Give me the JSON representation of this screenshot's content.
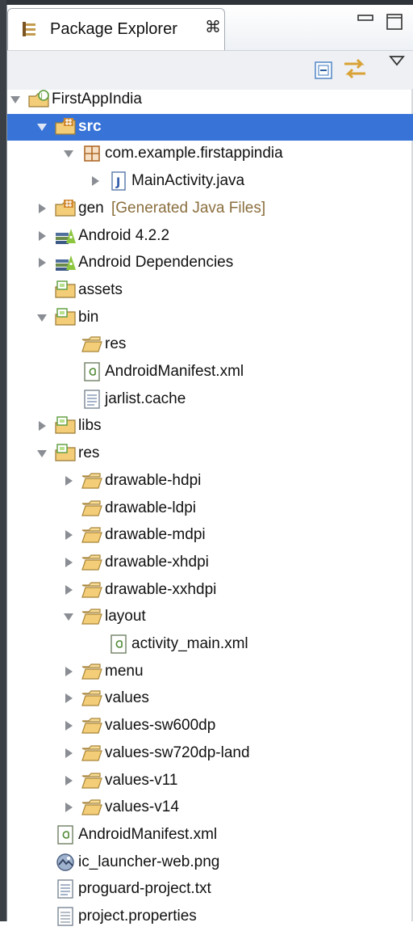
{
  "view": {
    "tab_title": "Package Explorer",
    "close_glyph": "⌘"
  },
  "tree": [
    {
      "id": "firstappindia",
      "label": "FirstAppIndia",
      "level": 0,
      "expanded": true,
      "icon": "android-project-icon"
    },
    {
      "id": "src",
      "label": "src",
      "level": 1,
      "expanded": true,
      "icon": "source-folder-icon",
      "selected": true
    },
    {
      "id": "com-example-firstappindia",
      "label": "com.example.firstappindia",
      "level": 2,
      "expanded": true,
      "icon": "package-icon"
    },
    {
      "id": "mainactivity-java",
      "label": "MainActivity.java",
      "level": 3,
      "expanded": false,
      "icon": "java-file-icon"
    },
    {
      "id": "gen",
      "label": "gen",
      "decoration": "[Generated Java Files]",
      "level": 1,
      "expanded": false,
      "icon": "source-folder-icon"
    },
    {
      "id": "android-4-2-2",
      "label": "Android 4.2.2",
      "level": 1,
      "expanded": false,
      "icon": "library-icon"
    },
    {
      "id": "android-dependencies",
      "label": "Android Dependencies",
      "level": 1,
      "expanded": false,
      "icon": "library-icon"
    },
    {
      "id": "assets",
      "label": "assets",
      "level": 1,
      "icon": "resource-folder-icon"
    },
    {
      "id": "bin",
      "label": "bin",
      "level": 1,
      "expanded": true,
      "icon": "resource-folder-icon"
    },
    {
      "id": "bin-res",
      "label": "res",
      "level": 2,
      "icon": "folder-icon"
    },
    {
      "id": "bin-androidmanifest",
      "label": "AndroidManifest.xml",
      "level": 2,
      "icon": "xml-file-icon"
    },
    {
      "id": "jarlist-cache",
      "label": "jarlist.cache",
      "level": 2,
      "icon": "text-file-icon"
    },
    {
      "id": "libs",
      "label": "libs",
      "level": 1,
      "expanded": false,
      "icon": "resource-folder-icon"
    },
    {
      "id": "res",
      "label": "res",
      "level": 1,
      "expanded": true,
      "icon": "resource-folder-icon"
    },
    {
      "id": "drawable-hdpi",
      "label": "drawable-hdpi",
      "level": 2,
      "expanded": false,
      "icon": "folder-icon"
    },
    {
      "id": "drawable-ldpi",
      "label": "drawable-ldpi",
      "level": 2,
      "icon": "folder-icon"
    },
    {
      "id": "drawable-mdpi",
      "label": "drawable-mdpi",
      "level": 2,
      "expanded": false,
      "icon": "folder-icon"
    },
    {
      "id": "drawable-xhdpi",
      "label": "drawable-xhdpi",
      "level": 2,
      "expanded": false,
      "icon": "folder-icon"
    },
    {
      "id": "drawable-xxhdpi",
      "label": "drawable-xxhdpi",
      "level": 2,
      "expanded": false,
      "icon": "folder-icon"
    },
    {
      "id": "layout",
      "label": "layout",
      "level": 2,
      "expanded": true,
      "icon": "folder-icon"
    },
    {
      "id": "activity-main-xml",
      "label": "activity_main.xml",
      "level": 3,
      "icon": "xml-file-icon"
    },
    {
      "id": "menu",
      "label": "menu",
      "level": 2,
      "expanded": false,
      "icon": "folder-icon"
    },
    {
      "id": "values",
      "label": "values",
      "level": 2,
      "expanded": false,
      "icon": "folder-icon"
    },
    {
      "id": "values-sw600dp",
      "label": "values-sw600dp",
      "level": 2,
      "expanded": false,
      "icon": "folder-icon"
    },
    {
      "id": "values-sw720dp-land",
      "label": "values-sw720dp-land",
      "level": 2,
      "expanded": false,
      "icon": "folder-icon"
    },
    {
      "id": "values-v11",
      "label": "values-v11",
      "level": 2,
      "expanded": false,
      "icon": "folder-icon"
    },
    {
      "id": "values-v14",
      "label": "values-v14",
      "level": 2,
      "expanded": false,
      "icon": "folder-icon"
    },
    {
      "id": "androidmanifest-xml",
      "label": "AndroidManifest.xml",
      "level": 1,
      "icon": "xml-file-icon"
    },
    {
      "id": "ic-launcher-web-png",
      "label": "ic_launcher-web.png",
      "level": 1,
      "icon": "image-file-icon"
    },
    {
      "id": "proguard-project-txt",
      "label": "proguard-project.txt",
      "level": 1,
      "icon": "text-file-icon"
    },
    {
      "id": "project-properties",
      "label": "project.properties",
      "level": 1,
      "icon": "properties-file-icon"
    }
  ],
  "colors": {
    "selection": "#3874d8",
    "folder": "#f3cd77",
    "decoration": "#8b6f3e"
  }
}
